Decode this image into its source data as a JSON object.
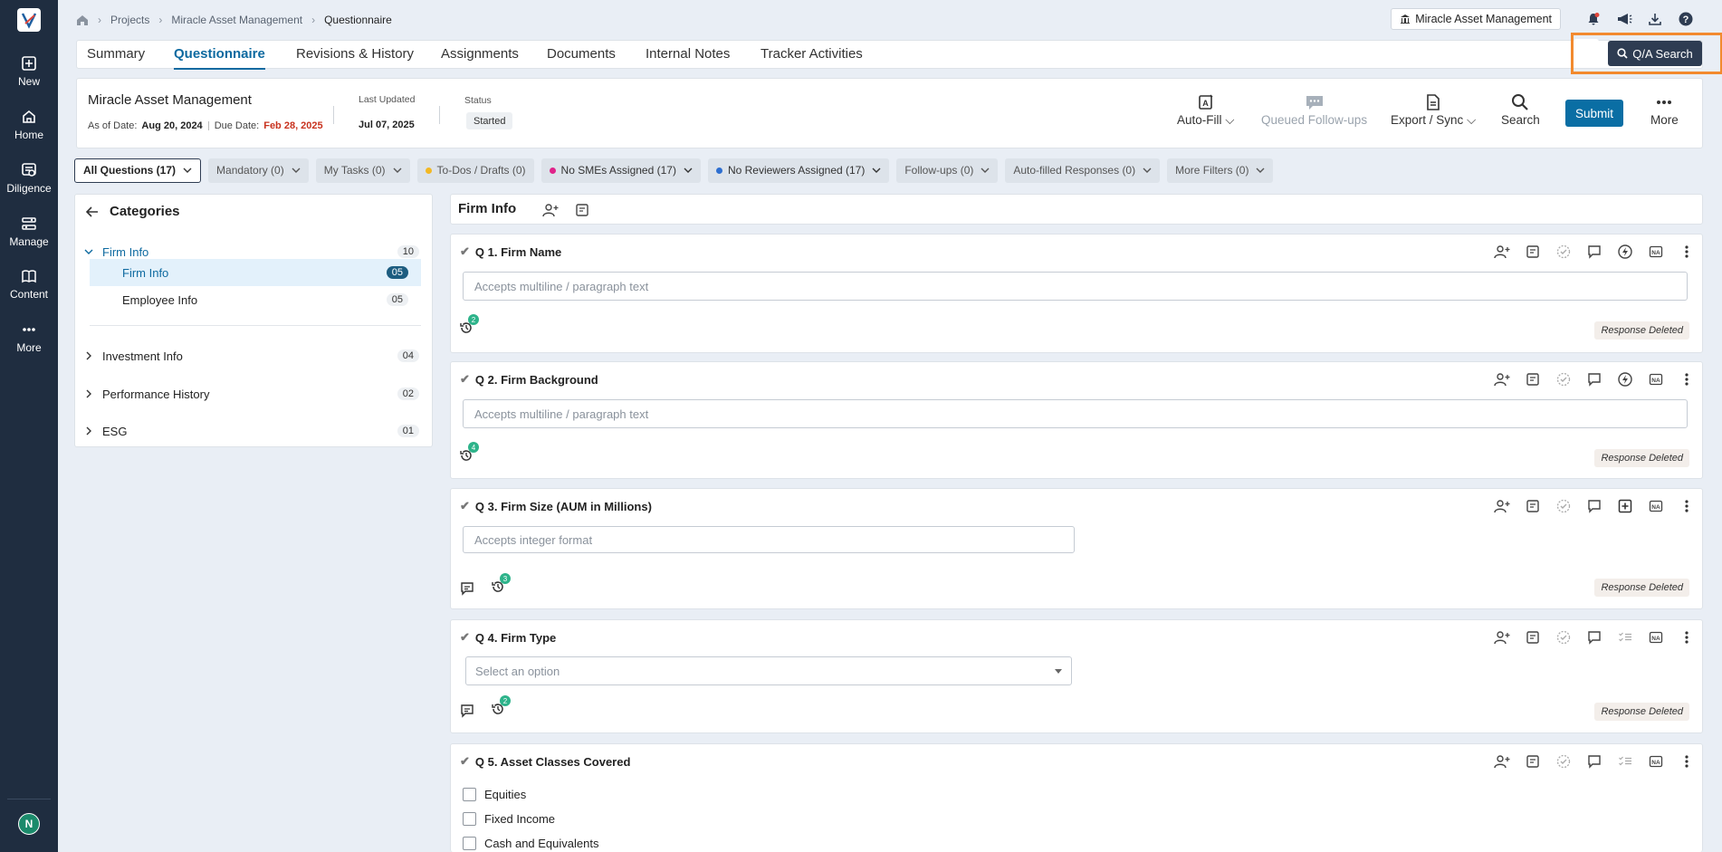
{
  "nav": {
    "items": [
      {
        "label": "New",
        "icon": "plus-square-icon"
      },
      {
        "label": "Home",
        "icon": "home-icon"
      },
      {
        "label": "Diligence",
        "icon": "diligence-icon"
      },
      {
        "label": "Manage",
        "icon": "manage-icon"
      },
      {
        "label": "Content",
        "icon": "book-icon"
      },
      {
        "label": "More",
        "icon": "ellipsis-icon"
      }
    ],
    "avatar": "N"
  },
  "breadcrumb": [
    "Projects",
    "Miracle Asset Management",
    "Questionnaire"
  ],
  "topbar": {
    "client_button": "Miracle Asset Management"
  },
  "tabs": [
    "Summary",
    "Questionnaire",
    "Revisions & History",
    "Assignments",
    "Documents",
    "Internal Notes",
    "Tracker Activities"
  ],
  "qa_search": "Q/A Search",
  "info": {
    "company": "Miracle Asset Management",
    "as_of_label": "As of Date:",
    "as_of_value": "Aug 20, 2024",
    "due_label": "Due Date:",
    "due_value": "Feb 28, 2025",
    "last_updated_label": "Last Updated",
    "last_updated_value": "Jul 07, 2025",
    "status_label": "Status",
    "status_value": "Started"
  },
  "actions": {
    "autofill": "Auto-Fill",
    "queued": "Queued Follow-ups",
    "export": "Export / Sync",
    "search": "Search",
    "submit": "Submit",
    "more": "More"
  },
  "filters": [
    {
      "label": "All Questions (17)"
    },
    {
      "label": "Mandatory (0)"
    },
    {
      "label": "My Tasks (0)"
    },
    {
      "label": "To-Dos / Drafts (0)"
    },
    {
      "label": "No SMEs Assigned (17)"
    },
    {
      "label": "No Reviewers Assigned (17)"
    },
    {
      "label": "Follow-ups (0)"
    },
    {
      "label": "Auto-filled Responses (0)"
    },
    {
      "label": "More Filters (0)"
    }
  ],
  "categories": {
    "title": "Categories",
    "items": [
      {
        "label": "Firm Info",
        "count": "10"
      },
      {
        "label": "Firm Info",
        "count": "05"
      },
      {
        "label": "Employee Info",
        "count": "05"
      },
      {
        "label": "Investment Info",
        "count": "04"
      },
      {
        "label": "Performance History",
        "count": "02"
      },
      {
        "label": "ESG",
        "count": "01"
      }
    ]
  },
  "section": {
    "title": "Firm Info"
  },
  "questions": [
    {
      "title": "Q 1. Firm Name",
      "placeholder": "Accepts multiline / paragraph text",
      "history_count": "2",
      "deleted": "Response Deleted"
    },
    {
      "title": "Q 2. Firm Background",
      "placeholder": "Accepts multiline / paragraph text",
      "history_count": "4",
      "deleted": "Response Deleted"
    },
    {
      "title": "Q 3. Firm Size (AUM in Millions)",
      "placeholder": "Accepts integer format",
      "history_count": "3",
      "deleted": "Response Deleted"
    },
    {
      "title": "Q 4. Firm Type",
      "placeholder": "Select an option",
      "history_count": "2",
      "deleted": "Response Deleted"
    },
    {
      "title": "Q 5. Asset Classes Covered",
      "options": [
        "Equities",
        "Fixed Income",
        "Cash and Equivalents"
      ]
    }
  ],
  "colors": {
    "sidebar": "#1f2d40",
    "accent": "#0e6aa0",
    "highlight": "#f28a2e",
    "due": "#c8321e"
  }
}
